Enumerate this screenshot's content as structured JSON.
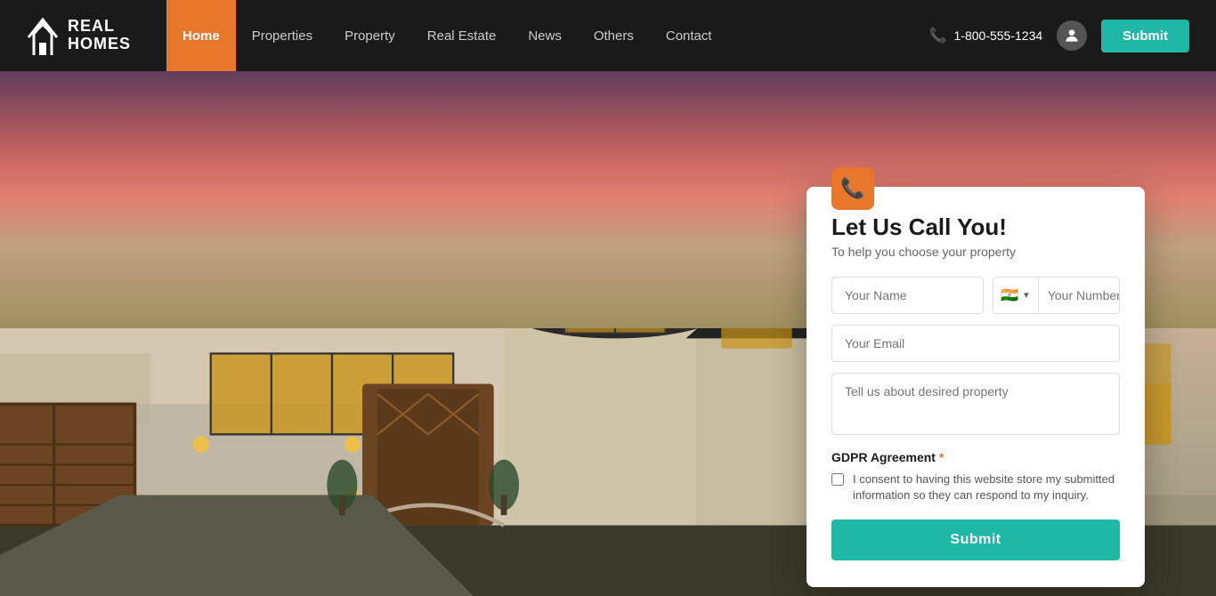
{
  "brand": {
    "name_line1": "REAL",
    "name_line2": "HOMES"
  },
  "navbar": {
    "links": [
      {
        "label": "Home",
        "active": true
      },
      {
        "label": "Properties",
        "active": false
      },
      {
        "label": "Property",
        "active": false
      },
      {
        "label": "Real Estate",
        "active": false
      },
      {
        "label": "News",
        "active": false
      },
      {
        "label": "Others",
        "active": false
      },
      {
        "label": "Contact",
        "active": false
      }
    ],
    "phone": "1-800-555-1234",
    "submit_label": "Submit"
  },
  "form": {
    "title": "Let Us Call You!",
    "subtitle": "To help you choose your property",
    "name_placeholder": "Your Name",
    "number_placeholder": "Your Number",
    "email_placeholder": "Your Email",
    "property_placeholder": "Tell us about desired property",
    "gdpr_label": "GDPR Agreement",
    "gdpr_text": "I consent to having this website store my submitted information so they can respond to my inquiry.",
    "submit_label": "Submit",
    "flag_emoji": "🇮🇳"
  }
}
